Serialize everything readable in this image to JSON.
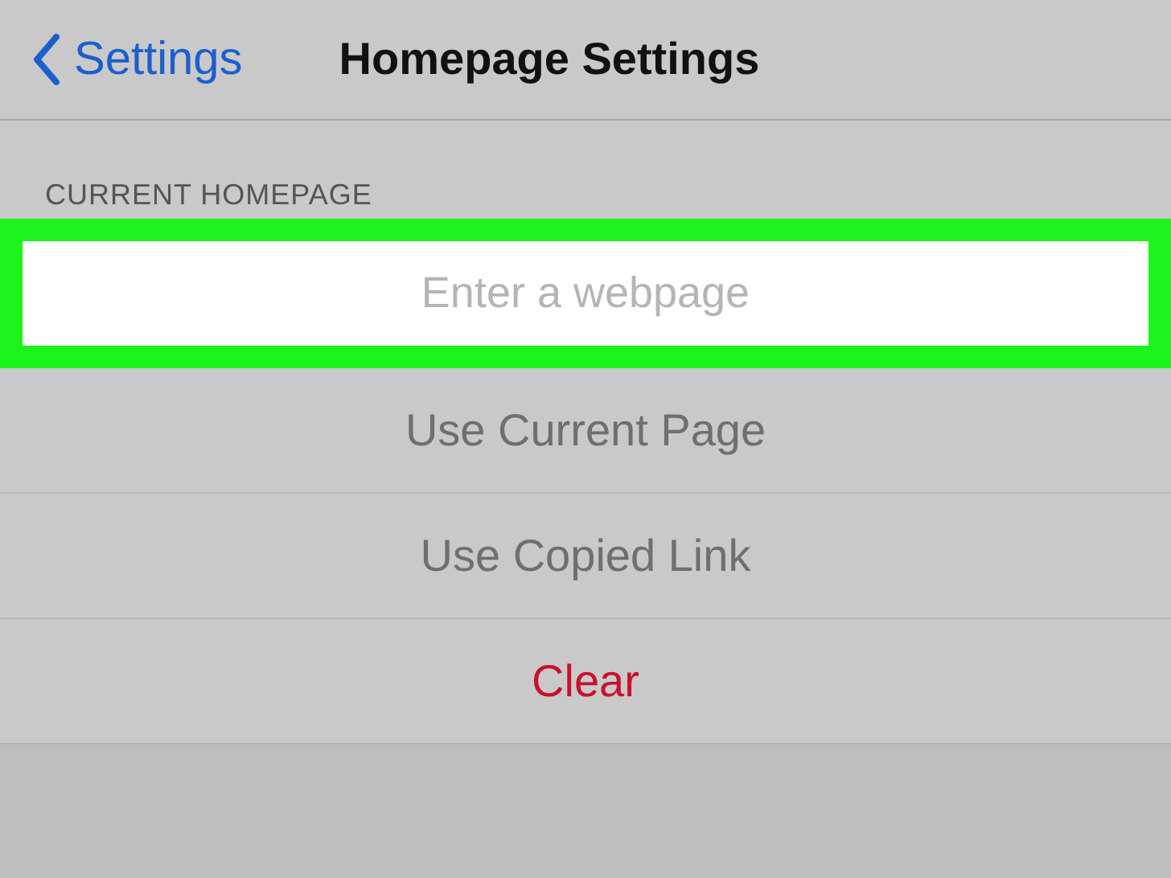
{
  "nav": {
    "back": "Settings",
    "title": "Homepage Settings"
  },
  "section": {
    "header": "CURRENT HOMEPAGE",
    "field": {
      "placeholder": "Enter a webpage",
      "highlighted": true
    }
  },
  "actions": [
    {
      "label": "Use Current Page",
      "kind": "normal"
    },
    {
      "label": "Use Copied Link",
      "kind": "normal"
    },
    {
      "label": "Clear",
      "kind": "destructive"
    }
  ]
}
